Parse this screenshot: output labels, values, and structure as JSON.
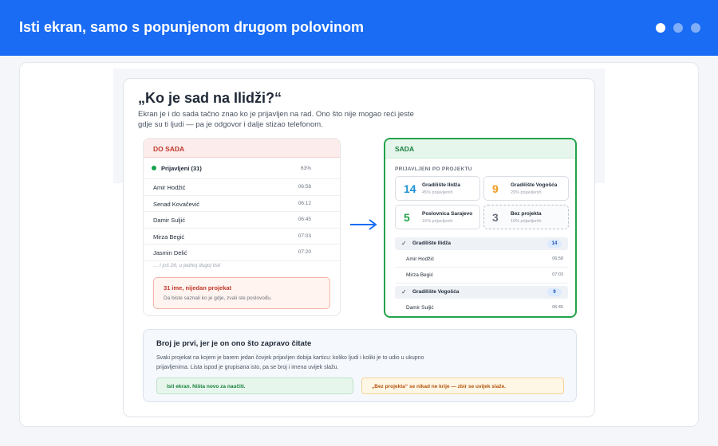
{
  "header": {
    "title": "Isti ekran, samo s popunjenom drugom polovinom",
    "dots": 3,
    "active_dot": 0
  },
  "slide": {
    "title": "„Ko je sad na Ilidži?“",
    "lead": "Ekran je i do sada tačno znao ko je prijavljen na rad. Ono što nije mogao reći jeste gdje su ti ljudi — pa je odgovor i dalje stizao telefonom."
  },
  "before": {
    "label": "DO SADA",
    "summary": {
      "name": "Prijavljeni (31)",
      "value": "63%"
    },
    "rows": [
      {
        "name": "Amir Hodžić",
        "time": "06:58"
      },
      {
        "name": "Senad Kovačević",
        "time": "06:12"
      },
      {
        "name": "Damir Suljić",
        "time": "06:45"
      },
      {
        "name": "Mirza Begić",
        "time": "07:03"
      },
      {
        "name": "Jasmin Delić",
        "time": "07:20"
      }
    ],
    "more": "… i još 26, u jednoj dugoj listi",
    "warning": {
      "title": "31 ime, nijedan projekat",
      "desc": "Da biste saznali ko je gdje, zvali ste poslovođu."
    }
  },
  "after": {
    "label": "SADA",
    "subtitle": "PRIJAVLJENI PO PROJEKTU",
    "cards": [
      {
        "num": "14",
        "name": "Gradilište Ilidža",
        "pct": "45% prijavljenih",
        "color": "#1a8fd6"
      },
      {
        "num": "9",
        "name": "Gradilište Vogošća",
        "pct": "29% prijavljenih",
        "color": "#f09a1a"
      },
      {
        "num": "5",
        "name": "Poslovnica Sarajevo",
        "pct": "16% prijavljenih",
        "color": "#22a34a"
      },
      {
        "num": "3",
        "name": "Bez projekta",
        "pct": "10% prijavljenih",
        "color": "#6b7280"
      }
    ],
    "groups": [
      {
        "name": "Gradilište Ilidža",
        "count": "14",
        "people": [
          {
            "name": "Amir Hodžić",
            "time": "06:58"
          },
          {
            "name": "Mirza Begić",
            "time": "07:03"
          }
        ]
      },
      {
        "name": "Gradilište Vogošća",
        "count": "9",
        "people": [
          {
            "name": "Damir Suljić",
            "time": "06:45"
          }
        ]
      }
    ]
  },
  "note": {
    "title": "Broj je prvi, jer je on ono što zapravo čitate",
    "body": "Svaki projekat na kojem je barem jedan čovjek prijavljen dobija karticu: koliko ljudi i koliki je to udio u ukupno prijavljenima. Lista ispod je grupisana isto, pa se broj i imena uvijek slažu.",
    "pill_green": "Isti ekran. Ništa novo za naučiti.",
    "pill_orange": "„Bez projekta“ se nikad ne krije — zbir se uvijek slaže."
  },
  "colors": {
    "brand": "#1a6cf4",
    "success": "#22a34a",
    "danger": "#c0392b",
    "warning": "#f09a1a"
  }
}
